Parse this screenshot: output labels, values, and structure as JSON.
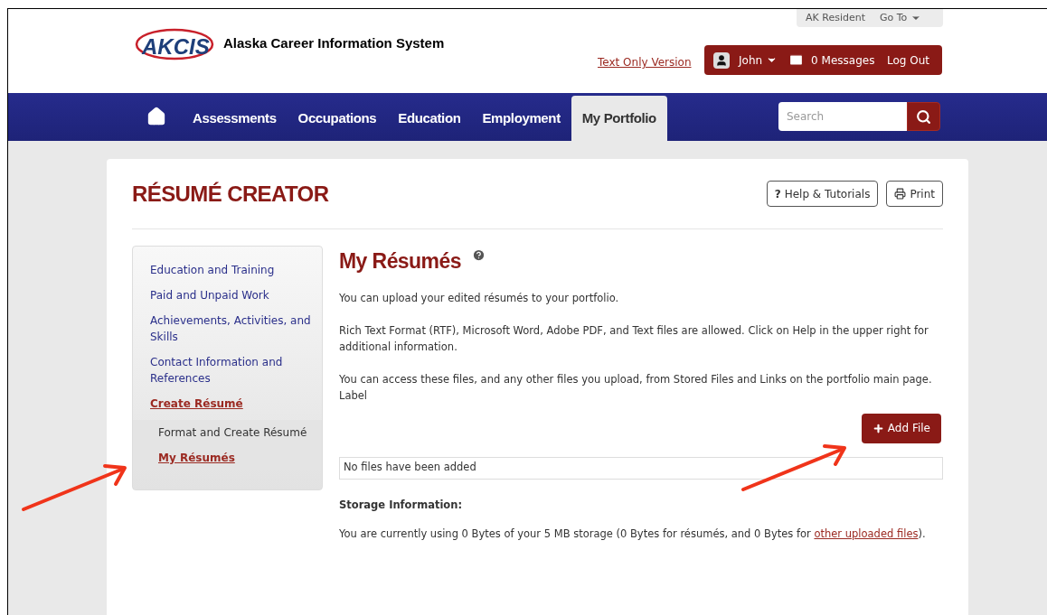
{
  "logo": {
    "text": "AKCIS"
  },
  "site_title": "Alaska Career Information System",
  "utility": {
    "resident": "AK Resident",
    "goto": "Go To"
  },
  "text_only_link": "Text Only Version",
  "user_bar": {
    "user": "John",
    "messages": "0 Messages",
    "logout": "Log Out"
  },
  "nav": {
    "tabs": [
      {
        "label": "Assessments",
        "selected": false
      },
      {
        "label": "Occupations",
        "selected": false
      },
      {
        "label": "Education",
        "selected": false
      },
      {
        "label": "Employment",
        "selected": false
      },
      {
        "label": "My Portfolio",
        "selected": true
      }
    ]
  },
  "search": {
    "placeholder": "Search"
  },
  "page_title": "RÉSUMÉ CREATOR",
  "actions": [
    {
      "kind": "help",
      "icon_char": "?",
      "label": "Help & Tutorials"
    },
    {
      "kind": "print",
      "label": "Print"
    }
  ],
  "sidebar": {
    "items": [
      {
        "label": "Education and Training",
        "selected": false
      },
      {
        "label": "Paid and Unpaid Work",
        "selected": false
      },
      {
        "label": "Achievements, Activities, and Skills",
        "selected": false
      },
      {
        "label": "Contact Information and References",
        "selected": false
      },
      {
        "label": "Create Résumé",
        "selected": true,
        "children": [
          {
            "label": "Format and Create Résumé",
            "selected": false
          },
          {
            "label": "My Résumés",
            "selected": true
          }
        ]
      }
    ]
  },
  "main": {
    "heading": "My Résumés",
    "paragraphs": [
      "You can upload your edited résumés to your portfolio.",
      "Rich Text Format (RTF), Microsoft Word, Adobe PDF, and Text files are allowed. Click on Help in the upper right for additional information.",
      "You can access these files, and any other files you upload, from Stored Files and Links on the portfolio main page."
    ],
    "label": "Label",
    "add_button": "Add File",
    "files_empty": "No files have been added",
    "storage_heading": "Storage Information:",
    "storage_text": {
      "before": "You are currently using 0 Bytes of your 5 MB storage (0 Bytes for résumés, and 0 Bytes for ",
      "link": "other uploaded files",
      "after": ")."
    }
  },
  "annotations": [
    {
      "kind": "arrow"
    },
    {
      "kind": "arrow"
    }
  ]
}
